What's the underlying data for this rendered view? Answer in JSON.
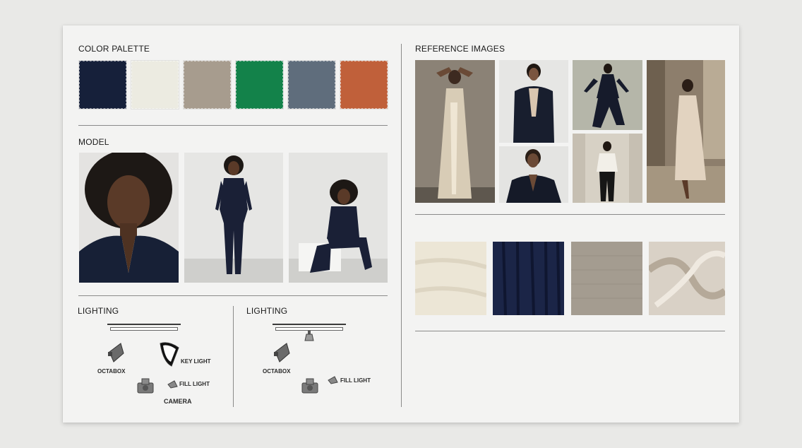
{
  "palette": {
    "heading": "COLOR PALETTE",
    "swatches": [
      "#16203a",
      "#ecebe1",
      "#a79c8e",
      "#13824a",
      "#5f6d7c",
      "#c0603a"
    ]
  },
  "model": {
    "heading": "MODEL",
    "photos": [
      "portrait-headshot",
      "standing-full-length-pose",
      "seated-pose-on-block"
    ]
  },
  "lighting_left": {
    "heading": "LIGHTING",
    "labels": {
      "octabox": "OCTABOX",
      "key_light": "KEY LIGHT",
      "fill_light": "FILL LIGHT",
      "camera": "CAMERA"
    }
  },
  "lighting_right": {
    "heading": "LIGHTING",
    "labels": {
      "octabox": "OCTABOX",
      "fill_light": "FILL LIGHT"
    }
  },
  "reference": {
    "heading": "REFERENCE IMAGES",
    "photos": [
      "satin-slip-dress",
      "navy-blazer-portrait",
      "walking-in-navy-suit",
      "navy-blazer-closeup",
      "white-blouse-black-trousers",
      "champagne-wrap-dress"
    ]
  },
  "fabrics": {
    "swatches": [
      {
        "name": "ivory-linen",
        "color": "#ece6d6"
      },
      {
        "name": "navy-pleat",
        "color": "#1b2547"
      },
      {
        "name": "taupe-weave",
        "color": "#a49c90"
      },
      {
        "name": "champagne-satin",
        "color": "#d9d1c6"
      }
    ]
  },
  "colors": {
    "board": "#f3f3f2",
    "background": "#e9e9e7",
    "rule": "#8a8a8a"
  }
}
